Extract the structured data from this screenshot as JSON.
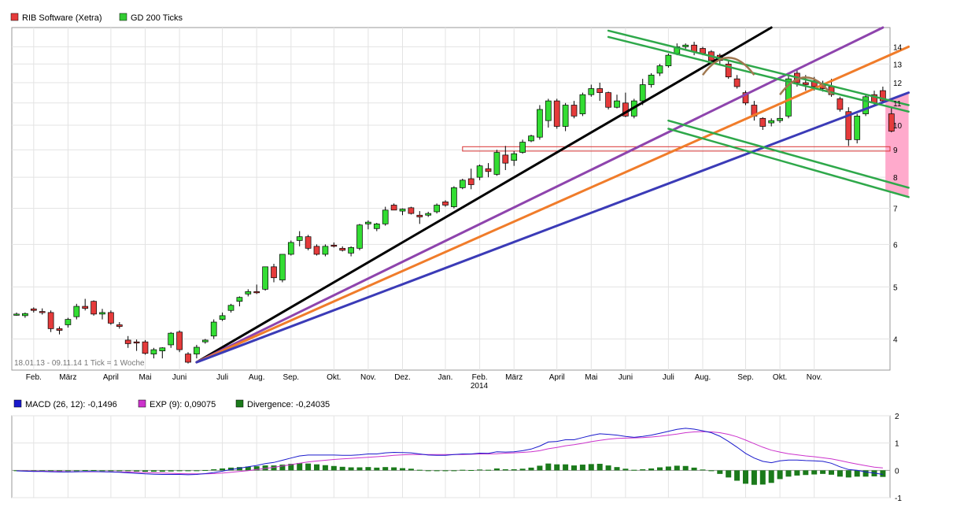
{
  "legend_top": [
    {
      "label": "RIB Software (Xetra)",
      "color": "#e53b3b"
    },
    {
      "label": "GD 200 Ticks",
      "color": "#33cc33"
    }
  ],
  "info_text": "18.01.13 - 09.11.14   1 Tick = 1 Woche",
  "year_label": "2014",
  "legend_bottom": [
    {
      "label": "MACD (26, 12): -0,1496",
      "color": "#1a1acc"
    },
    {
      "label": "EXP (9): 0,09075",
      "color": "#cc33cc"
    },
    {
      "label": "Divergence: -0,24035",
      "color": "#1b7a1b"
    }
  ],
  "chart_data": [
    {
      "type": "candlestick",
      "name": "RIB Software (Xetra)",
      "yscale": "log",
      "ylim": [
        3.5,
        15.2
      ],
      "yticks": [
        4,
        5,
        6,
        7,
        8,
        9,
        10,
        11,
        12,
        13,
        14
      ],
      "xticks": [
        {
          "label": "Feb.",
          "week": 2
        },
        {
          "label": "März",
          "week": 6
        },
        {
          "label": "April",
          "week": 11
        },
        {
          "label": "Mai",
          "week": 15
        },
        {
          "label": "Juni",
          "week": 19
        },
        {
          "label": "Juli",
          "week": 24
        },
        {
          "label": "Aug.",
          "week": 28
        },
        {
          "label": "Sep.",
          "week": 32
        },
        {
          "label": "Okt.",
          "week": 37
        },
        {
          "label": "Nov.",
          "week": 41
        },
        {
          "label": "Dez.",
          "week": 45
        },
        {
          "label": "Jan.",
          "week": 50
        },
        {
          "label": "Feb.",
          "week": 54
        },
        {
          "label": "März",
          "week": 58
        },
        {
          "label": "April",
          "week": 63
        },
        {
          "label": "Mai",
          "week": 67
        },
        {
          "label": "Juni",
          "week": 71
        },
        {
          "label": "Juli",
          "week": 76
        },
        {
          "label": "Aug.",
          "week": 80
        },
        {
          "label": "Sep.",
          "week": 85
        },
        {
          "label": "Okt.",
          "week": 89
        },
        {
          "label": "Nov.",
          "week": 93
        }
      ],
      "candles": [
        [
          4.45,
          4.48,
          4.42,
          4.45
        ],
        [
          4.42,
          4.48,
          4.38,
          4.46
        ],
        [
          4.55,
          4.58,
          4.48,
          4.52
        ],
        [
          4.5,
          4.56,
          4.44,
          4.48
        ],
        [
          4.48,
          4.52,
          4.12,
          4.18
        ],
        [
          4.18,
          4.22,
          4.08,
          4.15
        ],
        [
          4.25,
          4.38,
          4.2,
          4.35
        ],
        [
          4.4,
          4.65,
          4.35,
          4.6
        ],
        [
          4.6,
          4.75,
          4.52,
          4.56
        ],
        [
          4.7,
          4.72,
          4.42,
          4.45
        ],
        [
          4.45,
          4.55,
          4.35,
          4.48
        ],
        [
          4.48,
          4.52,
          4.25,
          4.28
        ],
        [
          4.25,
          4.3,
          4.18,
          4.22
        ],
        [
          3.98,
          4.05,
          3.85,
          3.92
        ],
        [
          3.95,
          3.99,
          3.8,
          3.93
        ],
        [
          3.95,
          3.98,
          3.74,
          3.76
        ],
        [
          3.75,
          3.85,
          3.68,
          3.82
        ],
        [
          3.8,
          3.86,
          3.68,
          3.85
        ],
        [
          3.9,
          4.12,
          3.85,
          4.1
        ],
        [
          4.12,
          4.15,
          3.78,
          3.82
        ],
        [
          3.75,
          3.78,
          3.6,
          3.62
        ],
        [
          3.75,
          3.9,
          3.68,
          3.86
        ],
        [
          3.95,
          4.0,
          3.92,
          3.98
        ],
        [
          4.05,
          4.35,
          4.0,
          4.3
        ],
        [
          4.35,
          4.48,
          4.32,
          4.42
        ],
        [
          4.52,
          4.65,
          4.48,
          4.62
        ],
        [
          4.7,
          4.8,
          4.6,
          4.78
        ],
        [
          4.85,
          4.95,
          4.8,
          4.9
        ],
        [
          4.9,
          5.05,
          4.85,
          4.88
        ],
        [
          4.95,
          5.45,
          4.92,
          5.45
        ],
        [
          5.45,
          5.52,
          5.1,
          5.2
        ],
        [
          5.15,
          5.75,
          5.1,
          5.75
        ],
        [
          5.75,
          6.1,
          5.72,
          6.05
        ],
        [
          6.1,
          6.35,
          5.95,
          6.2
        ],
        [
          6.2,
          6.25,
          5.85,
          5.9
        ],
        [
          5.95,
          6.0,
          5.72,
          5.75
        ],
        [
          5.75,
          6.0,
          5.7,
          5.95
        ],
        [
          5.98,
          6.05,
          5.92,
          5.95
        ],
        [
          5.9,
          5.95,
          5.82,
          5.85
        ],
        [
          5.78,
          5.95,
          5.7,
          5.92
        ],
        [
          5.9,
          6.55,
          5.85,
          6.52
        ],
        [
          6.55,
          6.65,
          6.4,
          6.6
        ],
        [
          6.42,
          6.58,
          6.35,
          6.55
        ],
        [
          6.55,
          7.05,
          6.5,
          6.95
        ],
        [
          7.1,
          7.15,
          6.95,
          6.95
        ],
        [
          6.92,
          7.0,
          6.8,
          6.98
        ],
        [
          7.02,
          7.05,
          6.82,
          6.85
        ],
        [
          6.8,
          6.92,
          6.55,
          6.75
        ],
        [
          6.8,
          6.9,
          6.75,
          6.85
        ],
        [
          6.9,
          7.15,
          6.85,
          7.1
        ],
        [
          7.2,
          7.25,
          7.05,
          7.1
        ],
        [
          7.05,
          7.7,
          7.0,
          7.65
        ],
        [
          7.65,
          7.95,
          7.6,
          7.9
        ],
        [
          7.95,
          8.3,
          7.6,
          7.75
        ],
        [
          8.0,
          8.45,
          7.9,
          8.4
        ],
        [
          8.3,
          8.5,
          8.0,
          8.2
        ],
        [
          8.1,
          9.0,
          8.05,
          8.9
        ],
        [
          8.8,
          9.15,
          8.25,
          8.5
        ],
        [
          8.6,
          8.95,
          8.4,
          8.85
        ],
        [
          8.9,
          9.4,
          8.85,
          9.3
        ],
        [
          9.35,
          9.6,
          9.3,
          9.55
        ],
        [
          9.5,
          10.9,
          9.4,
          10.7
        ],
        [
          10.2,
          11.2,
          9.9,
          11.1
        ],
        [
          11.1,
          11.2,
          9.85,
          9.95
        ],
        [
          9.95,
          11.0,
          9.75,
          10.9
        ],
        [
          10.9,
          11.1,
          10.3,
          10.4
        ],
        [
          10.5,
          11.5,
          10.4,
          11.4
        ],
        [
          11.4,
          11.9,
          11.3,
          11.7
        ],
        [
          11.7,
          12.0,
          11.1,
          11.5
        ],
        [
          11.5,
          11.55,
          10.7,
          10.8
        ],
        [
          10.8,
          11.4,
          10.75,
          11.1
        ],
        [
          11.0,
          11.5,
          10.35,
          10.4
        ],
        [
          10.4,
          11.2,
          10.3,
          11.1
        ],
        [
          11.1,
          12.2,
          10.9,
          11.9
        ],
        [
          11.9,
          12.5,
          11.75,
          12.4
        ],
        [
          12.5,
          13.0,
          12.35,
          12.9
        ],
        [
          12.9,
          13.6,
          12.8,
          13.5
        ],
        [
          13.6,
          14.2,
          13.5,
          14.0
        ],
        [
          14.0,
          14.2,
          13.85,
          14.1
        ],
        [
          14.1,
          14.3,
          13.5,
          13.7
        ],
        [
          13.9,
          14.0,
          13.5,
          13.6
        ],
        [
          13.7,
          13.8,
          13.1,
          13.2
        ],
        [
          13.5,
          13.6,
          13.0,
          13.2
        ],
        [
          13.0,
          13.2,
          12.2,
          12.3
        ],
        [
          12.2,
          12.4,
          11.7,
          11.8
        ],
        [
          11.5,
          11.6,
          10.9,
          11.0
        ],
        [
          10.9,
          11.1,
          10.2,
          10.4
        ],
        [
          10.3,
          10.35,
          9.8,
          9.95
        ],
        [
          10.1,
          10.3,
          9.95,
          10.2
        ],
        [
          10.2,
          10.85,
          10.1,
          10.3
        ],
        [
          10.4,
          12.5,
          10.3,
          12.2
        ],
        [
          12.5,
          12.7,
          11.8,
          12.0
        ],
        [
          12.0,
          12.4,
          11.6,
          11.9
        ],
        [
          12.1,
          12.3,
          11.6,
          11.8
        ],
        [
          11.95,
          12.1,
          11.55,
          11.7
        ],
        [
          11.8,
          12.2,
          11.3,
          11.4
        ],
        [
          11.2,
          11.3,
          10.6,
          10.7
        ],
        [
          10.6,
          10.8,
          9.15,
          9.4
        ],
        [
          9.4,
          10.5,
          9.25,
          10.4
        ],
        [
          10.5,
          11.4,
          10.4,
          11.3
        ],
        [
          11.4,
          11.6,
          10.9,
          11.0
        ],
        [
          11.6,
          11.8,
          11.0,
          11.1
        ],
        [
          10.5,
          10.8,
          9.7,
          9.75
        ]
      ],
      "trendlines": [
        {
          "color": "#000000",
          "from": [
            21,
            3.62
          ],
          "to": [
            88,
            15.2
          ]
        },
        {
          "color": "#8e44ad",
          "from": [
            21,
            3.62
          ],
          "to": [
            101,
            15.2
          ]
        },
        {
          "color": "#f07c2a",
          "from": [
            21,
            3.62
          ],
          "to": [
            104,
            14.0
          ]
        },
        {
          "color": "#3b3bb7",
          "from": [
            21,
            3.62
          ],
          "to": [
            104,
            11.5
          ]
        }
      ],
      "channel_lines": [
        {
          "color": "#2ea84a",
          "from": [
            69,
            15.0
          ],
          "to": [
            104,
            10.9
          ]
        },
        {
          "color": "#2ea84a",
          "from": [
            69,
            14.6
          ],
          "to": [
            104,
            10.6
          ]
        },
        {
          "color": "#2ea84a",
          "from": [
            76,
            10.2
          ],
          "to": [
            104,
            7.65
          ]
        },
        {
          "color": "#2ea84a",
          "from": [
            76,
            9.85
          ],
          "to": [
            104,
            7.35
          ]
        }
      ],
      "support_band": [
        8.95,
        9.12
      ],
      "arcs": [
        [
          80,
          12.4,
          86
        ],
        [
          89,
          11.4,
          95
        ]
      ]
    },
    {
      "type": "macd",
      "ylim": [
        -1,
        2
      ],
      "yticks": [
        -1,
        0,
        1,
        2
      ],
      "series": [
        {
          "name": "MACD (26, 12)",
          "color": "#1a1acc",
          "values": [
            -0.02,
            -0.03,
            -0.04,
            -0.04,
            -0.05,
            -0.06,
            -0.06,
            -0.05,
            -0.04,
            -0.04,
            -0.05,
            -0.06,
            -0.07,
            -0.09,
            -0.11,
            -0.13,
            -0.14,
            -0.15,
            -0.15,
            -0.15,
            -0.16,
            -0.15,
            -0.12,
            -0.08,
            -0.03,
            0.03,
            0.08,
            0.13,
            0.18,
            0.25,
            0.29,
            0.37,
            0.45,
            0.53,
            0.56,
            0.56,
            0.56,
            0.56,
            0.55,
            0.55,
            0.57,
            0.6,
            0.6,
            0.64,
            0.66,
            0.65,
            0.64,
            0.6,
            0.56,
            0.55,
            0.55,
            0.58,
            0.6,
            0.6,
            0.63,
            0.62,
            0.68,
            0.67,
            0.68,
            0.72,
            0.78,
            0.89,
            1.04,
            1.06,
            1.12,
            1.12,
            1.2,
            1.28,
            1.34,
            1.32,
            1.29,
            1.24,
            1.21,
            1.24,
            1.29,
            1.36,
            1.43,
            1.5,
            1.54,
            1.51,
            1.45,
            1.38,
            1.25,
            1.06,
            0.85,
            0.62,
            0.45,
            0.33,
            0.28,
            0.35,
            0.38,
            0.38,
            0.36,
            0.35,
            0.33,
            0.26,
            0.13,
            0.03,
            0.0,
            -0.06,
            -0.1,
            -0.15
          ]
        },
        {
          "name": "EXP (9)",
          "color": "#cc33cc",
          "values": [
            -0.02,
            -0.02,
            -0.03,
            -0.03,
            -0.04,
            -0.04,
            -0.05,
            -0.05,
            -0.05,
            -0.05,
            -0.05,
            -0.05,
            -0.06,
            -0.06,
            -0.07,
            -0.08,
            -0.09,
            -0.1,
            -0.11,
            -0.12,
            -0.13,
            -0.13,
            -0.13,
            -0.12,
            -0.1,
            -0.07,
            -0.04,
            -0.01,
            0.03,
            0.07,
            0.11,
            0.16,
            0.21,
            0.26,
            0.31,
            0.34,
            0.37,
            0.4,
            0.42,
            0.44,
            0.46,
            0.48,
            0.5,
            0.52,
            0.55,
            0.57,
            0.58,
            0.58,
            0.58,
            0.58,
            0.58,
            0.58,
            0.58,
            0.59,
            0.6,
            0.6,
            0.61,
            0.63,
            0.64,
            0.66,
            0.68,
            0.72,
            0.79,
            0.84,
            0.9,
            0.94,
            0.99,
            1.05,
            1.1,
            1.14,
            1.17,
            1.18,
            1.19,
            1.2,
            1.22,
            1.25,
            1.29,
            1.33,
            1.38,
            1.41,
            1.42,
            1.41,
            1.38,
            1.32,
            1.23,
            1.11,
            0.98,
            0.85,
            0.74,
            0.67,
            0.61,
            0.57,
            0.53,
            0.5,
            0.46,
            0.42,
            0.36,
            0.29,
            0.23,
            0.17,
            0.12,
            0.09
          ]
        },
        {
          "name": "Divergence",
          "color": "#1b7a1b",
          "values": [
            0.0,
            -0.01,
            -0.01,
            -0.01,
            -0.01,
            -0.02,
            -0.01,
            0.0,
            0.01,
            0.01,
            0.0,
            -0.01,
            -0.01,
            -0.03,
            -0.04,
            -0.05,
            -0.05,
            -0.05,
            -0.04,
            -0.03,
            -0.03,
            -0.02,
            0.01,
            0.04,
            0.07,
            0.1,
            0.12,
            0.14,
            0.15,
            0.18,
            0.18,
            0.21,
            0.24,
            0.27,
            0.25,
            0.22,
            0.19,
            0.16,
            0.13,
            0.11,
            0.11,
            0.12,
            0.1,
            0.12,
            0.11,
            0.08,
            0.06,
            0.02,
            -0.02,
            -0.03,
            -0.03,
            0.0,
            0.02,
            0.01,
            0.03,
            0.02,
            0.07,
            0.04,
            0.04,
            0.06,
            0.1,
            0.17,
            0.25,
            0.22,
            0.22,
            0.18,
            0.21,
            0.23,
            0.24,
            0.18,
            0.12,
            0.06,
            0.02,
            0.04,
            0.07,
            0.11,
            0.14,
            0.17,
            0.16,
            0.1,
            0.03,
            -0.03,
            -0.13,
            -0.26,
            -0.38,
            -0.49,
            -0.53,
            -0.52,
            -0.46,
            -0.32,
            -0.23,
            -0.19,
            -0.17,
            -0.15,
            -0.13,
            -0.16,
            -0.23,
            -0.26,
            -0.23,
            -0.23,
            -0.22,
            -0.24
          ]
        }
      ]
    }
  ]
}
